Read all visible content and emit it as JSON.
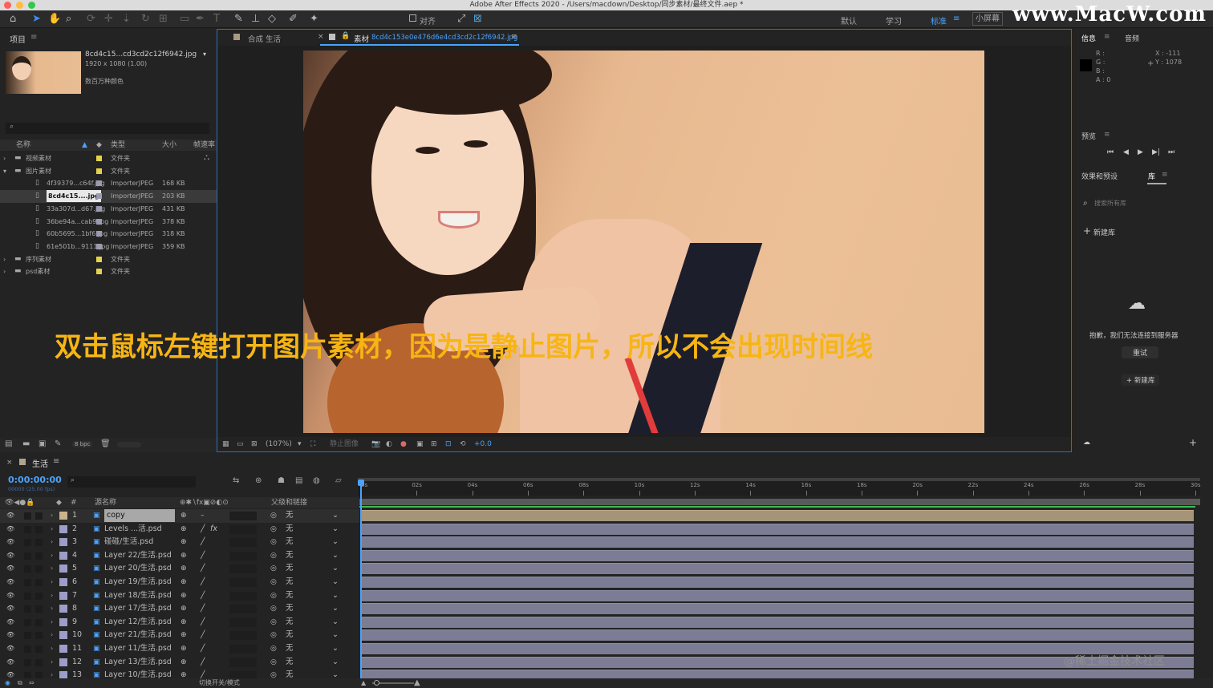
{
  "window": {
    "title": "Adobe After Effects 2020 - /Users/macdown/Desktop/同步素材/最终文件.aep *"
  },
  "toolbar": {
    "snap_label": "对齐",
    "workspaces": [
      "默认",
      "学习",
      "标准",
      "小屏幕"
    ],
    "active_workspace": "标准",
    "search_icon": "search-help-icon"
  },
  "watermark": "www.MacW.com",
  "project": {
    "panel_title": "项目",
    "selected_file": "8cd4c15...cd3cd2c12f6942.jpg",
    "dims": "1920 x 1080 (1.00)",
    "color_depth": "数百万种颜色",
    "columns": {
      "name": "名称",
      "type": "类型",
      "size": "大小",
      "fps": "帧速率"
    },
    "rows": [
      {
        "name": "视频素材",
        "type": "文件夹",
        "size": "",
        "kind": "folder",
        "color": "#e4d24a"
      },
      {
        "name": "图片素材",
        "type": "文件夹",
        "size": "",
        "kind": "folder",
        "color": "#e4d24a"
      },
      {
        "name": "4f39379...c64f.jpg",
        "type": "ImporterJPEG",
        "size": "168 KB",
        "kind": "file",
        "color": "#9b9bb0"
      },
      {
        "name": "8cd4c15....jpg",
        "type": "ImporterJPEG",
        "size": "203 KB",
        "kind": "file",
        "color": "#9b9bb0",
        "selected": true
      },
      {
        "name": "33a307d...d67.jpg",
        "type": "ImporterJPEG",
        "size": "431 KB",
        "kind": "file",
        "color": "#9b9bb0"
      },
      {
        "name": "36be94a...cab9.jpg",
        "type": "ImporterJPEG",
        "size": "378 KB",
        "kind": "file",
        "color": "#9b9bb0"
      },
      {
        "name": "60b5695...1bf6.jpg",
        "type": "ImporterJPEG",
        "size": "318 KB",
        "kind": "file",
        "color": "#9b9bb0"
      },
      {
        "name": "61e501b...9111.jpg",
        "type": "ImporterJPEG",
        "size": "359 KB",
        "kind": "file",
        "color": "#9b9bb0"
      },
      {
        "name": "序列素材",
        "type": "文件夹",
        "size": "",
        "kind": "folder",
        "color": "#e4d24a"
      },
      {
        "name": "psd素材",
        "type": "文件夹",
        "size": "",
        "kind": "folder",
        "color": "#e4d24a"
      }
    ],
    "bpc": "8 bpc"
  },
  "viewer": {
    "tab_comp": "合成 生活",
    "tab_footage_prefix": "素材",
    "tab_footage_file": "8cd4c153e0e476d6e4cd3cd2c12f6942.jpg",
    "zoom": "(107%)",
    "still_label": "静止图像",
    "exposure": "+0.0",
    "overlay_text": "双击鼠标左键打开图片素材，因为是静止图片，所以不会出现时间线"
  },
  "info": {
    "tab_info": "信息",
    "tab_audio": "音频",
    "r": "R :",
    "g": "G :",
    "b": "B :",
    "a": "A :  0",
    "x": "X : -111",
    "y": "Y : 1078"
  },
  "preview": {
    "title": "预览"
  },
  "library": {
    "tab_effects": "效果和预设",
    "tab_library": "库",
    "search_placeholder": "搜索所有库",
    "new_library": "新建库",
    "error": "抱歉，我们无法连接到服务器",
    "retry": "重试",
    "new_library2": "+ 新建库"
  },
  "timeline": {
    "comp": "生活",
    "timecode": "0:00:00:00",
    "fps": "00000 (25.00 fps)",
    "col_source": "源名称",
    "col_parent": "父级和链接",
    "ticks": [
      "0s",
      "02s",
      "04s",
      "06s",
      "08s",
      "10s",
      "12s",
      "14s",
      "16s",
      "18s",
      "20s",
      "22s",
      "24s",
      "26s",
      "28s",
      "30s"
    ],
    "layers": [
      {
        "num": "1",
        "name": "copy",
        "parent": "无",
        "color": "#c9b38a"
      },
      {
        "num": "2",
        "name": "Levels ...活.psd",
        "parent": "无",
        "color": "#9d9dc9"
      },
      {
        "num": "3",
        "name": "碰碰/生活.psd",
        "parent": "无",
        "color": "#9d9dc9"
      },
      {
        "num": "4",
        "name": "Layer 22/生活.psd",
        "parent": "无",
        "color": "#9d9dc9"
      },
      {
        "num": "5",
        "name": "Layer 20/生活.psd",
        "parent": "无",
        "color": "#9d9dc9"
      },
      {
        "num": "6",
        "name": "Layer 19/生活.psd",
        "parent": "无",
        "color": "#9d9dc9"
      },
      {
        "num": "7",
        "name": "Layer 18/生活.psd",
        "parent": "无",
        "color": "#9d9dc9"
      },
      {
        "num": "8",
        "name": "Layer 17/生活.psd",
        "parent": "无",
        "color": "#9d9dc9"
      },
      {
        "num": "9",
        "name": "Layer 12/生活.psd",
        "parent": "无",
        "color": "#9d9dc9"
      },
      {
        "num": "10",
        "name": "Layer 21/生活.psd",
        "parent": "无",
        "color": "#9d9dc9"
      },
      {
        "num": "11",
        "name": "Layer 11/生活.psd",
        "parent": "无",
        "color": "#9d9dc9"
      },
      {
        "num": "12",
        "name": "Layer 13/生活.psd",
        "parent": "无",
        "color": "#9d9dc9"
      },
      {
        "num": "13",
        "name": "Layer 10/生活.psd",
        "parent": "无",
        "color": "#9d9dc9"
      }
    ],
    "toggle_label": "切换开关/模式",
    "credit": "@稀土掘金技术社区"
  }
}
